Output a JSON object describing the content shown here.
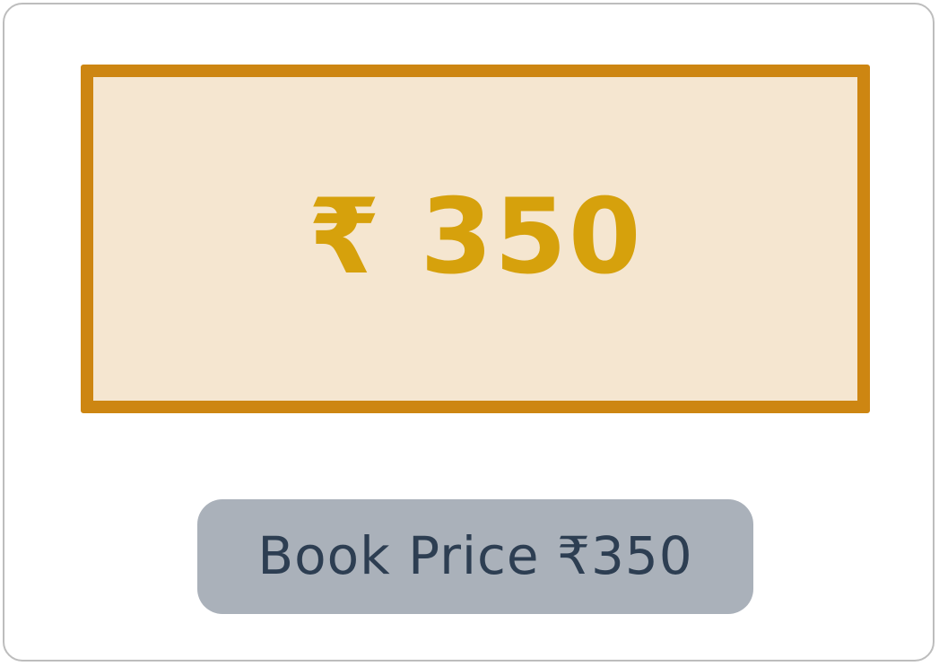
{
  "price_display": {
    "text": "₹ 350"
  },
  "price_label": {
    "text": "Book Price ₹350"
  },
  "colors": {
    "box_border": "#cd8612",
    "box_fill": "#f5e6d0",
    "price_text": "#d6a10c",
    "label_fill": "#aab1ba",
    "label_text": "#2d3e52"
  }
}
